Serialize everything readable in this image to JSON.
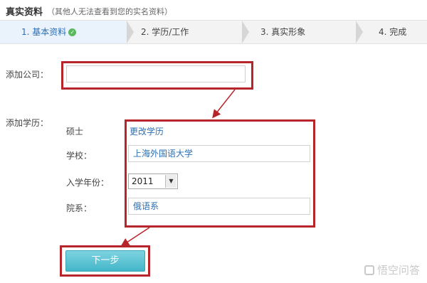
{
  "header": {
    "title": "真实资料",
    "subtitle": "（其他人无法查看到您的实名资料）"
  },
  "steps": [
    {
      "label": "1. 基本资料",
      "state": "done"
    },
    {
      "label": "2. 学历/工作",
      "state": "pending"
    },
    {
      "label": "3. 真实形象",
      "state": "pending"
    },
    {
      "label": "4. 完成",
      "state": "pending"
    }
  ],
  "form": {
    "company_label": "添加公司：",
    "company_value": "",
    "education_label": "添加学历：",
    "degree": "硕士",
    "change_link": "更改学历",
    "school_label": "学校：",
    "school_value": "上海外国语大学",
    "year_label": "入学年份：",
    "year_value": "2011",
    "department_label": "院系：",
    "department_value": "俄语系"
  },
  "actions": {
    "next_label": "下一步"
  },
  "watermark": "悟空问答",
  "colors": {
    "highlight_red": "#b5252a",
    "link_blue": "#2a6fb3",
    "button_teal": "#43b6c9"
  }
}
